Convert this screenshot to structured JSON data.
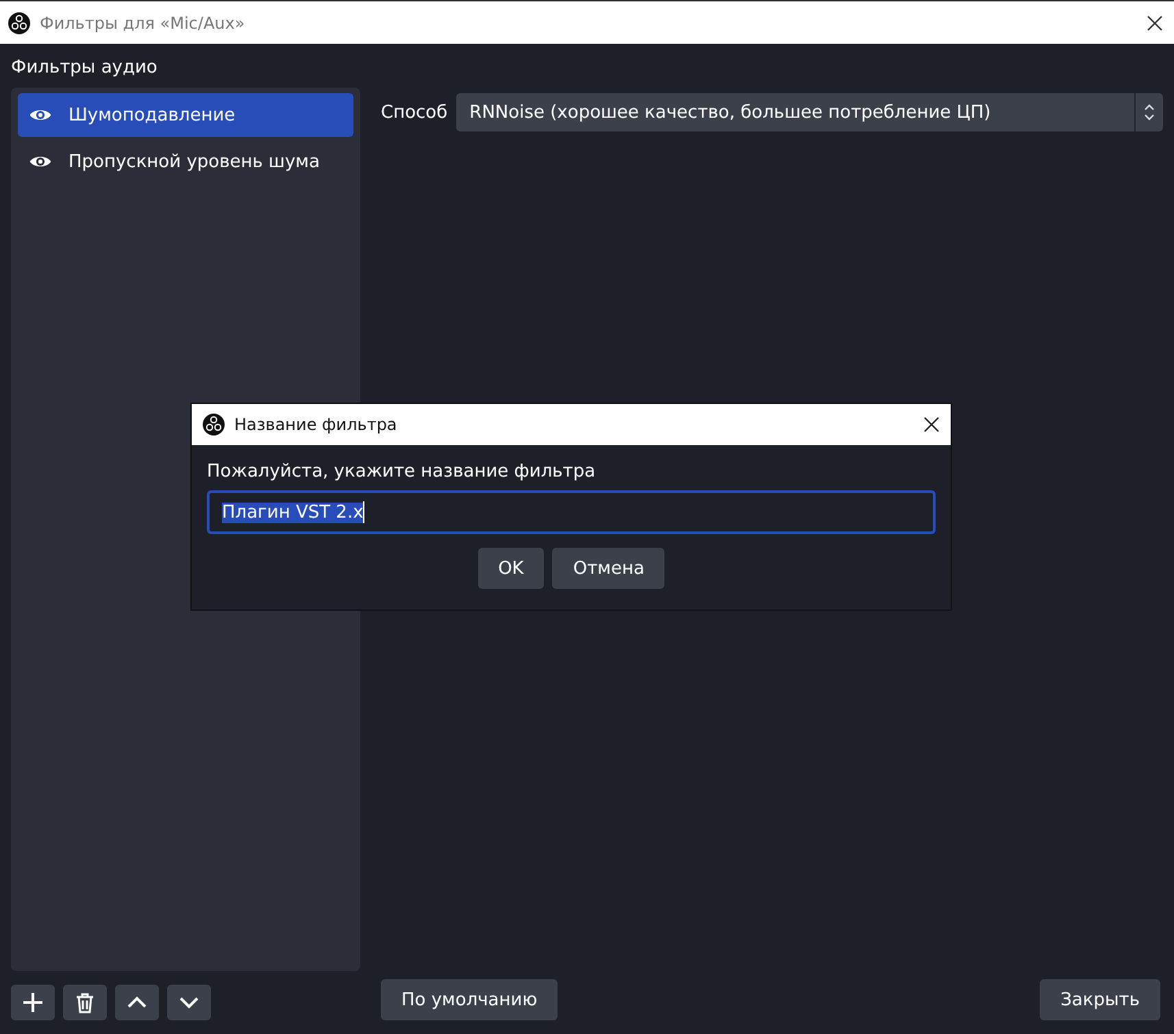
{
  "window": {
    "title": "Фильтры для «Mic/Aux»"
  },
  "section_label": "Фильтры аудио",
  "filters": [
    {
      "name": "Шумоподавление",
      "visible": true,
      "selected": true
    },
    {
      "name": "Пропускной уровень шума",
      "visible": true,
      "selected": false
    }
  ],
  "method": {
    "label": "Способ",
    "value": "RNNoise (хорошее качество, большее потребление ЦП)"
  },
  "toolbar": {
    "defaults_button": "По умолчанию",
    "close_button": "Закрыть"
  },
  "dialog": {
    "title": "Название фильтра",
    "prompt": "Пожалуйста, укажите название фильтра",
    "value": "Плагин VST 2.x",
    "value_selected": true,
    "buttons": [
      "OK",
      "Отмена"
    ]
  }
}
